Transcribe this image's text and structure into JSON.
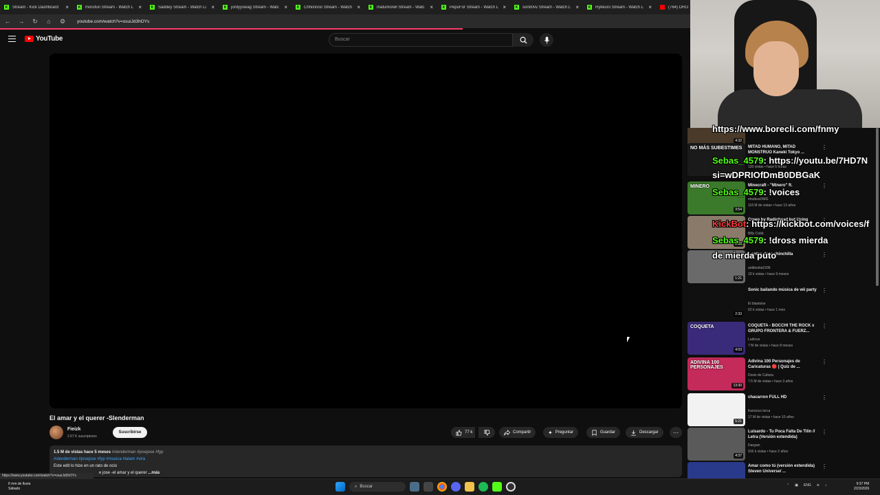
{
  "browser": {
    "tabs": [
      {
        "label": "Stream - Kick Dashboard",
        "icon": "kick-icon"
      },
      {
        "label": "morufun Stream - Watch L",
        "icon": "kick-icon"
      },
      {
        "label": "Saddey Stream - Watch Li",
        "icon": "kick-icon"
      },
      {
        "label": "jordyyswag Stream - Watc",
        "icon": "kick-icon"
      },
      {
        "label": "Chhiinnoo Stream - Watch",
        "icon": "kick-icon"
      },
      {
        "label": "matumorell Stream - Watc",
        "icon": "kick-icon"
      },
      {
        "label": "PepuFor Stream - Watch L",
        "icon": "kick-icon"
      },
      {
        "label": "sonti0vv Stream - Watch L",
        "icon": "kick-icon"
      },
      {
        "label": "Rykkuro Stream - Watch L",
        "icon": "kick-icon"
      },
      {
        "label": "(764) DRO",
        "icon": "youtube-icon"
      }
    ],
    "url": "youtube.com/watch?v=osuiJd3hOYs",
    "status_url": "https://www.youtube.com/watch?v=osuiJd3hOYs"
  },
  "youtube": {
    "logo_text": "YouTube",
    "search_placeholder": "Buscar",
    "video": {
      "title": "El amar y el querer -Slenderman",
      "channel": "Fieizk",
      "subscribers": "2.67 K suscriptores",
      "subscribe_label": "Suscribirse",
      "likes": "77 k",
      "share": "Compartir",
      "ask": "Preguntar",
      "save": "Guardar",
      "download": "Descargar",
      "desc_stats": "1.5 M de vistas  hace 5 meses",
      "desc_tags_1": "#slenderman #josejose #fyp",
      "desc_tags_2": "#slenderman #josejose #fyp #musica #latam #vira",
      "desc_line": "Este edit lo hize en un rato de ocio",
      "desc_line2": "e jose -el amar y el querer",
      "more": "...más"
    },
    "sidebar": [
      {
        "title": "",
        "channel": "",
        "meta": "",
        "duration": "4:32"
      },
      {
        "title": "MITAD HUMANO, MITAD MONSTRUO Kaneki Tokyo ...",
        "channel": "",
        "meta": "120 vistas • hace 5 horas",
        "duration": ""
      },
      {
        "title": "Minecraft - \"Minero\" ft.",
        "channel": "elrubiusOMG",
        "meta": "116 M de vistas • hace 13 años",
        "duration": "3:54"
      },
      {
        "title": "Creep by Radiohead but Using",
        "channel": "Billy Cobb",
        "meta": "",
        "duration": "2:28"
      },
      {
        "title": "...entes de la chinchilla",
        "channel": "antibestia1936",
        "meta": "19 k vistas • hace 9 meses",
        "duration": "1:21"
      },
      {
        "title": "Sonic bailando música de wii party",
        "channel": "El blastoise",
        "meta": "62 k vistas • hace 1 mes",
        "duration": "2:33"
      },
      {
        "title": "COQUETA - BOCCHI THE ROCK x GRUPO FRONTERA & FUERZ...",
        "channel": "Ludicus",
        "meta": "7 M de vistas • hace 8 meses",
        "duration": "4:03"
      },
      {
        "title": "Adivina 100 Personajes de Caricaturas 🔴 | Quiz de ...",
        "channel": "Dosis de Cultura",
        "meta": "7.5 M de vistas • hace 3 años",
        "duration": "13:30"
      },
      {
        "title": "chacarron FULL HD",
        "channel": "francisco lorca",
        "meta": "17 M de vistas • hace 10 años",
        "duration": "5:21"
      },
      {
        "title": "Luisardo - Tu Poca Falta De Tilín // Letra (Versión extendida)",
        "channel": "Dargain",
        "meta": "916 k vistas • hace 2 años",
        "duration": "4:37"
      },
      {
        "title": "Amar como tú (versión extendida) Steven Universe/ ...",
        "channel": "",
        "meta": "",
        "duration": ""
      }
    ],
    "sidebar_thumb_texts": {
      "t1": "NO MÁS SUBESTIMES",
      "t2": "MINERO",
      "t6": "COQUETA",
      "t7": "ADIVINA 100 PERSONAJES"
    }
  },
  "chat_overlay": [
    {
      "user": "",
      "text": "https://www.borecli.com/fnmy"
    },
    {
      "user": "Sebas_4579",
      "text": ": https://youtu.be/7HD7N"
    },
    {
      "user": "",
      "text": "si=wDPRIOfDmB0DBGaK"
    },
    {
      "user": "Sebas_4579",
      "text": ": !voices"
    },
    {
      "user": "KickBot",
      "text": ": https://kickbot.com/voices/f"
    },
    {
      "user": "Sebas_4579",
      "text": ": !dross mierda"
    },
    {
      "user": "",
      "text": "de mierda puto"
    }
  ],
  "taskbar": {
    "weather_temp": "6 mm de lluvia",
    "weather_day": "Sábado",
    "search": "Buscar",
    "lang": "ENG",
    "time": "9:37 PM",
    "date": "2/23/2026"
  },
  "colors": {
    "kick": "#53fc18",
    "youtube": "#ff0000",
    "link": "#3ea6ff"
  }
}
